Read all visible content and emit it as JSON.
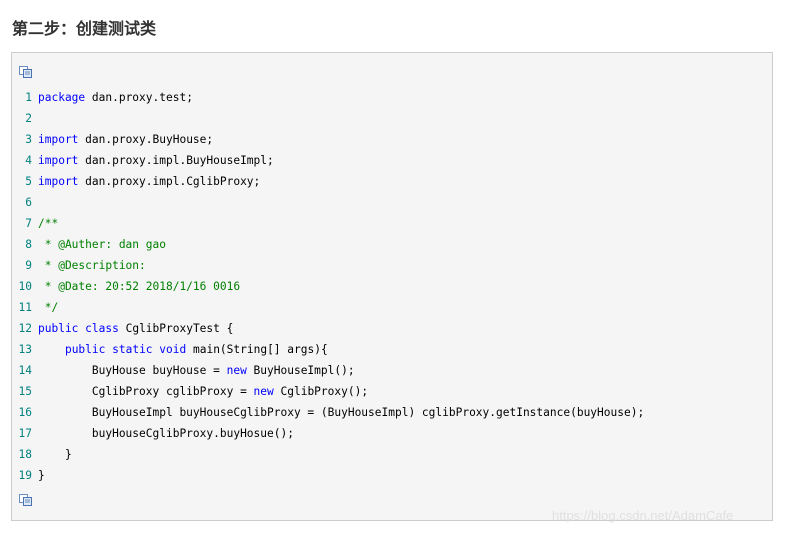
{
  "heading": "第二步：创建测试类",
  "copy_icon": "copy-code-icon",
  "colors": {
    "keyword": "#0000ff",
    "comment": "#008000",
    "line_number": "#008080",
    "code_bg": "#f5f5f5",
    "border": "#cccccc"
  },
  "code": [
    {
      "n": "1",
      "segs": [
        [
          "kw",
          "package"
        ],
        [
          "",
          " dan.proxy.test;"
        ]
      ]
    },
    {
      "n": "2",
      "segs": []
    },
    {
      "n": "3",
      "segs": [
        [
          "kw",
          "import"
        ],
        [
          "",
          " dan.proxy.BuyHouse;"
        ]
      ]
    },
    {
      "n": "4",
      "segs": [
        [
          "kw",
          "import"
        ],
        [
          "",
          " dan.proxy.impl.BuyHouseImpl;"
        ]
      ]
    },
    {
      "n": "5",
      "segs": [
        [
          "kw",
          "import"
        ],
        [
          "",
          " dan.proxy.impl.CglibProxy;"
        ]
      ]
    },
    {
      "n": "6",
      "segs": []
    },
    {
      "n": "7",
      "segs": [
        [
          "cm",
          "/**"
        ]
      ]
    },
    {
      "n": "8",
      "segs": [
        [
          "cm",
          " * @Auther: dan gao"
        ]
      ]
    },
    {
      "n": "9",
      "segs": [
        [
          "cm",
          " * @Description:"
        ]
      ]
    },
    {
      "n": "10",
      "segs": [
        [
          "cm",
          " * @Date: 20:52 2018/1/16 0016"
        ]
      ]
    },
    {
      "n": "11",
      "segs": [
        [
          "cm",
          " */"
        ]
      ]
    },
    {
      "n": "12",
      "segs": [
        [
          "kw",
          "public"
        ],
        [
          "",
          " "
        ],
        [
          "kw",
          "class"
        ],
        [
          "",
          " CglibProxyTest {"
        ]
      ]
    },
    {
      "n": "13",
      "segs": [
        [
          "",
          "    "
        ],
        [
          "kw",
          "public"
        ],
        [
          "",
          " "
        ],
        [
          "kw",
          "static"
        ],
        [
          "",
          " "
        ],
        [
          "kw",
          "void"
        ],
        [
          "",
          " main(String[] args){"
        ]
      ]
    },
    {
      "n": "14",
      "segs": [
        [
          "",
          "        BuyHouse buyHouse = "
        ],
        [
          "kw",
          "new"
        ],
        [
          "",
          " BuyHouseImpl();"
        ]
      ]
    },
    {
      "n": "15",
      "segs": [
        [
          "",
          "        CglibProxy cglibProxy = "
        ],
        [
          "kw",
          "new"
        ],
        [
          "",
          " CglibProxy();"
        ]
      ]
    },
    {
      "n": "16",
      "segs": [
        [
          "",
          "        BuyHouseImpl buyHouseCglibProxy = (BuyHouseImpl) cglibProxy.getInstance(buyHouse);"
        ]
      ]
    },
    {
      "n": "17",
      "segs": [
        [
          "",
          "        buyHouseCglibProxy.buyHosue();"
        ]
      ]
    },
    {
      "n": "18",
      "segs": [
        [
          "",
          "    }"
        ]
      ]
    },
    {
      "n": "19",
      "segs": [
        [
          "",
          "}"
        ]
      ]
    }
  ],
  "watermark": "https://blog.csdn.net/AdamCafe"
}
